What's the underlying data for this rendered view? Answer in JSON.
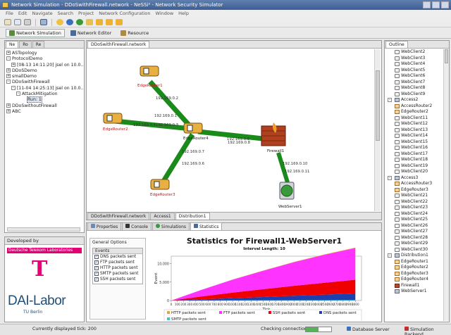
{
  "window": {
    "title": "Network Simulation - DDoSwithFirewall.network - NeSSi² - Network Security Simulator"
  },
  "menu": [
    "File",
    "Edit",
    "Navigate",
    "Search",
    "Project",
    "Network Configuration",
    "Window",
    "Help"
  ],
  "perspectives": [
    {
      "label": "Network Simulation",
      "active": true
    },
    {
      "label": "Network Editor",
      "active": false
    },
    {
      "label": "Resource",
      "active": false
    }
  ],
  "left_tabs": [
    "Ne",
    "Ro",
    "Re"
  ],
  "project_tree": [
    {
      "label": "ASTopology",
      "indent": 0,
      "exp": "+"
    },
    {
      "label": "ProtocolDemo",
      "indent": 0,
      "exp": "-"
    },
    {
      "label": "[08-13 14:11:20] jsel on 10.0...",
      "indent": 1,
      "exp": "+"
    },
    {
      "label": "DDoSDemo",
      "indent": 0,
      "exp": "+"
    },
    {
      "label": "smallDemo",
      "indent": 0,
      "exp": "+"
    },
    {
      "label": "DDoSwithFirewall",
      "indent": 0,
      "exp": "-"
    },
    {
      "label": "[11-04 14:25:13] jsel on 10.0...",
      "indent": 1,
      "exp": "-"
    },
    {
      "label": "AttackMitigation",
      "indent": 2,
      "exp": "-"
    },
    {
      "label": "Run: 1",
      "indent": 3,
      "exp": ""
    },
    {
      "label": "DDoSwithoutFirewall",
      "indent": 0,
      "exp": "+"
    },
    {
      "label": "ABC",
      "indent": 0,
      "exp": "+"
    }
  ],
  "developed_by": {
    "title": "Developed by",
    "lab": "Deutsche Telekom Laboratories",
    "logo_letter": "T",
    "dai": "DAI-Labor",
    "dai_sub": "TU Berlin"
  },
  "editor": {
    "tab": "DDoSwithFirewall.network",
    "bottom_tabs": [
      "DDoSwithFirewall.network",
      "Access1",
      "Distribution1"
    ],
    "nodes": {
      "edge1": "EdgeRouter1",
      "edge2": "EdgeRouter2",
      "edge3": "EdgeRouter3",
      "edge4": "EdgeRouter4",
      "firewall": "Firewall1",
      "webserver": "WebServer1"
    },
    "ips": {
      "e1": "192.169.0.2",
      "e1b": "192.169.0.1",
      "e2a": "192.169.0.4",
      "e2b": "192.169.0.3",
      "fw_a": "192.169.0.9",
      "fw_b": "192.169.0.8",
      "e3a": "192.169.0.7",
      "e3b": "192.169.0.6",
      "ws_a": "192.169.0.10",
      "ws_b": "192.169.0.11"
    }
  },
  "bottom_tabs": [
    "Properties",
    "Console",
    "Simulations",
    "Statistics"
  ],
  "general_options": {
    "title": "General Options",
    "events_header": "Events",
    "events": [
      "DNS packets sent",
      "FTP packets sent",
      "HTTP packets sent",
      "SMTP packets sent",
      "SSH packets sent"
    ]
  },
  "chart_data": {
    "type": "area",
    "title": "Statistics for Firewall1-WebServer1",
    "subtitle": "Interval Length: 10",
    "xlabel": "Tick",
    "ylabel": "Event",
    "xlim": [
      0,
      3100
    ],
    "ylim": [
      0,
      12000
    ],
    "x_ticks": [
      0,
      100,
      200,
      300,
      400,
      500,
      600,
      700,
      800,
      900,
      1000,
      1100,
      1200,
      1300,
      1400,
      1500,
      1600,
      1700,
      1800,
      1900,
      2000,
      2100,
      2200,
      2300,
      2400,
      2500,
      2600,
      2700,
      2800,
      2900,
      3000
    ],
    "y_ticks": [
      0,
      5000,
      10000
    ],
    "y_tick_labels": [
      "0",
      "5,000",
      "10,000"
    ],
    "x": [
      0,
      500,
      1000,
      1500,
      2000,
      2500,
      3000
    ],
    "series": [
      {
        "name": "HTTP packets sent",
        "color": "#f0a030",
        "values": [
          0,
          20,
          40,
          60,
          80,
          100,
          120
        ]
      },
      {
        "name": "FTP packets sent",
        "color": "#ff33ff",
        "values": [
          0,
          1800,
          3500,
          5000,
          6400,
          7600,
          8600
        ]
      },
      {
        "name": "SSH packets sent",
        "color": "#ee0000",
        "values": [
          0,
          800,
          1500,
          2100,
          2700,
          3200,
          3700
        ]
      },
      {
        "name": "DNS packets sent",
        "color": "#1f3fae",
        "values": [
          0,
          300,
          600,
          900,
          1200,
          1500,
          1800
        ]
      },
      {
        "name": "SMTP packets sent",
        "color": "#33cccc",
        "values": [
          0,
          20,
          40,
          60,
          80,
          100,
          120
        ]
      }
    ]
  },
  "outline": {
    "tab": "Outline",
    "items": [
      {
        "label": "WebClient2",
        "indent": 2,
        "icon": "wc"
      },
      {
        "label": "WebClient3",
        "indent": 2,
        "icon": "wc"
      },
      {
        "label": "WebClient4",
        "indent": 2,
        "icon": "wc"
      },
      {
        "label": "WebClient5",
        "indent": 2,
        "icon": "wc"
      },
      {
        "label": "WebClient6",
        "indent": 2,
        "icon": "wc"
      },
      {
        "label": "WebClient7",
        "indent": 2,
        "icon": "wc"
      },
      {
        "label": "WebClient8",
        "indent": 2,
        "icon": "wc"
      },
      {
        "label": "WebClient9",
        "indent": 2,
        "icon": "wc"
      },
      {
        "label": "Access2",
        "indent": 0,
        "icon": "sw",
        "exp": "-"
      },
      {
        "label": "AccessRouter2",
        "indent": 2,
        "icon": "router"
      },
      {
        "label": "EdgeRouter2",
        "indent": 2,
        "icon": "router"
      },
      {
        "label": "WebClient11",
        "indent": 2,
        "icon": "wc"
      },
      {
        "label": "WebClient12",
        "indent": 2,
        "icon": "wc"
      },
      {
        "label": "WebClient13",
        "indent": 2,
        "icon": "wc"
      },
      {
        "label": "WebClient14",
        "indent": 2,
        "icon": "wc"
      },
      {
        "label": "WebClient15",
        "indent": 2,
        "icon": "wc"
      },
      {
        "label": "WebClient16",
        "indent": 2,
        "icon": "wc"
      },
      {
        "label": "WebClient17",
        "indent": 2,
        "icon": "wc"
      },
      {
        "label": "WebClient18",
        "indent": 2,
        "icon": "wc"
      },
      {
        "label": "WebClient19",
        "indent": 2,
        "icon": "wc"
      },
      {
        "label": "WebClient20",
        "indent": 2,
        "icon": "wc"
      },
      {
        "label": "Access3",
        "indent": 0,
        "icon": "sw",
        "exp": "-"
      },
      {
        "label": "AccessRouter3",
        "indent": 2,
        "icon": "router"
      },
      {
        "label": "EdgeRouter3",
        "indent": 2,
        "icon": "router"
      },
      {
        "label": "WebClient21",
        "indent": 2,
        "icon": "wc"
      },
      {
        "label": "WebClient22",
        "indent": 2,
        "icon": "wc"
      },
      {
        "label": "WebClient23",
        "indent": 2,
        "icon": "wc"
      },
      {
        "label": "WebClient24",
        "indent": 2,
        "icon": "wc"
      },
      {
        "label": "WebClient25",
        "indent": 2,
        "icon": "wc"
      },
      {
        "label": "WebClient26",
        "indent": 2,
        "icon": "wc"
      },
      {
        "label": "WebClient27",
        "indent": 2,
        "icon": "wc"
      },
      {
        "label": "WebClient28",
        "indent": 2,
        "icon": "wc"
      },
      {
        "label": "WebClient29",
        "indent": 2,
        "icon": "wc"
      },
      {
        "label": "WebClient30",
        "indent": 2,
        "icon": "wc"
      },
      {
        "label": "Distribution1",
        "indent": 0,
        "icon": "sw",
        "exp": "-"
      },
      {
        "label": "EdgeRouter1",
        "indent": 2,
        "icon": "router"
      },
      {
        "label": "EdgeRouter2",
        "indent": 2,
        "icon": "router"
      },
      {
        "label": "EdgeRouter3",
        "indent": 2,
        "icon": "router"
      },
      {
        "label": "EdgeRouter4",
        "indent": 2,
        "icon": "router"
      },
      {
        "label": "Firewall1",
        "indent": 2,
        "icon": "fw"
      },
      {
        "label": "WebServer1",
        "indent": 2,
        "icon": "sw"
      }
    ]
  },
  "status": {
    "tick": "Currently displayed tick: 200",
    "checking": "Checking connections ...: (50%)",
    "db": "Database Server",
    "sim": "Simulation Backend"
  }
}
